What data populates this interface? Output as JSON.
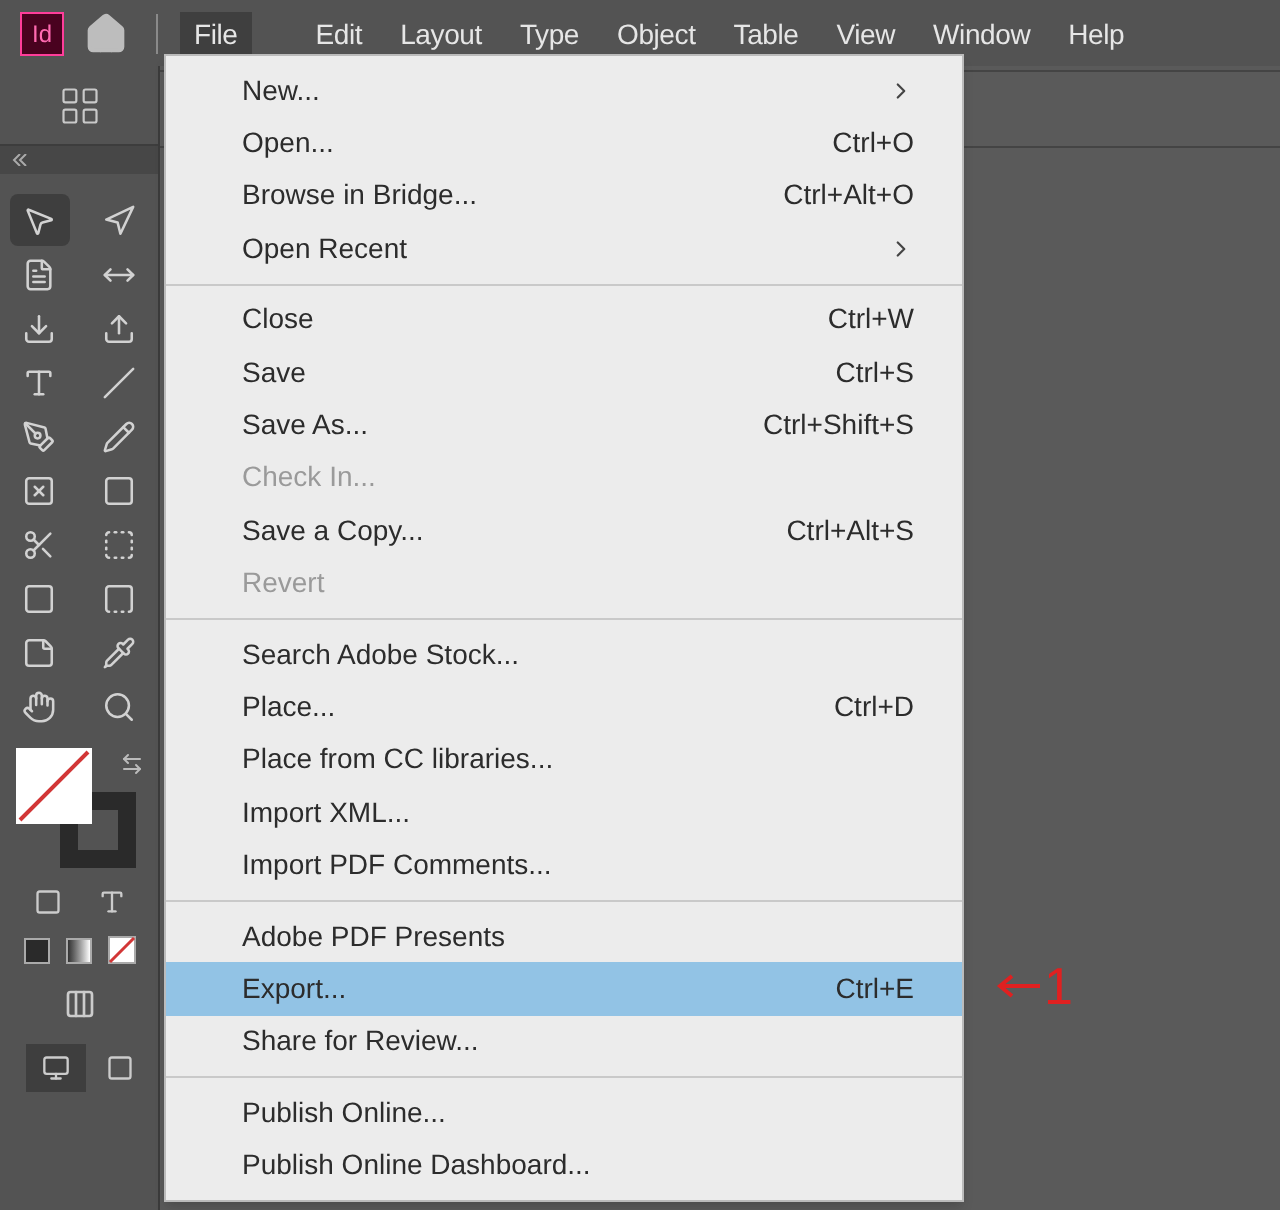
{
  "app_badge": "Id",
  "menubar": [
    {
      "label": "File",
      "selected": true
    },
    {
      "label": "Edit",
      "selected": false
    },
    {
      "label": "Layout",
      "selected": false
    },
    {
      "label": "Type",
      "selected": false
    },
    {
      "label": "Object",
      "selected": false
    },
    {
      "label": "Table",
      "selected": false
    },
    {
      "label": "View",
      "selected": false
    },
    {
      "label": "Window",
      "selected": false
    },
    {
      "label": "Help",
      "selected": false
    }
  ],
  "tools": [
    {
      "kind": "selection",
      "selected": true
    },
    {
      "kind": "direct",
      "selected": false
    },
    {
      "kind": "page",
      "selected": false
    },
    {
      "kind": "gap",
      "selected": false
    },
    {
      "kind": "collector",
      "selected": false
    },
    {
      "kind": "placer",
      "selected": false
    },
    {
      "kind": "type",
      "selected": false
    },
    {
      "kind": "line",
      "selected": false
    },
    {
      "kind": "pen",
      "selected": false
    },
    {
      "kind": "pencil",
      "selected": false
    },
    {
      "kind": "frame",
      "selected": false
    },
    {
      "kind": "rectangle",
      "selected": false
    },
    {
      "kind": "scissors",
      "selected": false
    },
    {
      "kind": "transform",
      "selected": false
    },
    {
      "kind": "gradient",
      "selected": false
    },
    {
      "kind": "feather",
      "selected": false
    },
    {
      "kind": "note",
      "selected": false
    },
    {
      "kind": "eyedropper",
      "selected": false
    },
    {
      "kind": "hand",
      "selected": false
    },
    {
      "kind": "zoom",
      "selected": false
    }
  ],
  "file_menu": {
    "sections": [
      [
        {
          "label": "New...",
          "submenu": true,
          "disabled": false,
          "selected": false
        },
        {
          "label": "Open...",
          "shortcut": "Ctrl+O",
          "disabled": false,
          "selected": false
        },
        {
          "label": "Browse in Bridge...",
          "shortcut": "Ctrl+Alt+O",
          "disabled": false,
          "selected": false
        },
        {
          "label": "Open Recent",
          "submenu": true,
          "disabled": false,
          "selected": false
        }
      ],
      [
        {
          "label": "Close",
          "shortcut": "Ctrl+W",
          "disabled": false,
          "selected": false
        },
        {
          "label": "Save",
          "shortcut": "Ctrl+S",
          "disabled": false,
          "selected": false
        },
        {
          "label": "Save As...",
          "shortcut": "Ctrl+Shift+S",
          "disabled": false,
          "selected": false
        },
        {
          "label": "Check In...",
          "disabled": true,
          "selected": false
        },
        {
          "label": "Save a Copy...",
          "shortcut": "Ctrl+Alt+S",
          "disabled": false,
          "selected": false
        },
        {
          "label": "Revert",
          "disabled": true,
          "selected": false
        }
      ],
      [
        {
          "label": "Search Adobe Stock...",
          "disabled": false,
          "selected": false
        },
        {
          "label": "Place...",
          "shortcut": "Ctrl+D",
          "disabled": false,
          "selected": false
        },
        {
          "label": "Place from CC libraries...",
          "disabled": false,
          "selected": false
        },
        {
          "label": "Import XML...",
          "disabled": false,
          "selected": false
        },
        {
          "label": "Import PDF Comments...",
          "disabled": false,
          "selected": false
        }
      ],
      [
        {
          "label": "Adobe PDF Presents",
          "disabled": false,
          "selected": false
        },
        {
          "label": "Export...",
          "shortcut": "Ctrl+E",
          "disabled": false,
          "selected": true
        },
        {
          "label": "Share for Review...",
          "disabled": false,
          "selected": false
        }
      ],
      [
        {
          "label": "Publish Online...",
          "disabled": false,
          "selected": false
        },
        {
          "label": "Publish Online Dashboard...",
          "disabled": false,
          "selected": false
        }
      ]
    ]
  },
  "annotation": {
    "label": "1"
  }
}
